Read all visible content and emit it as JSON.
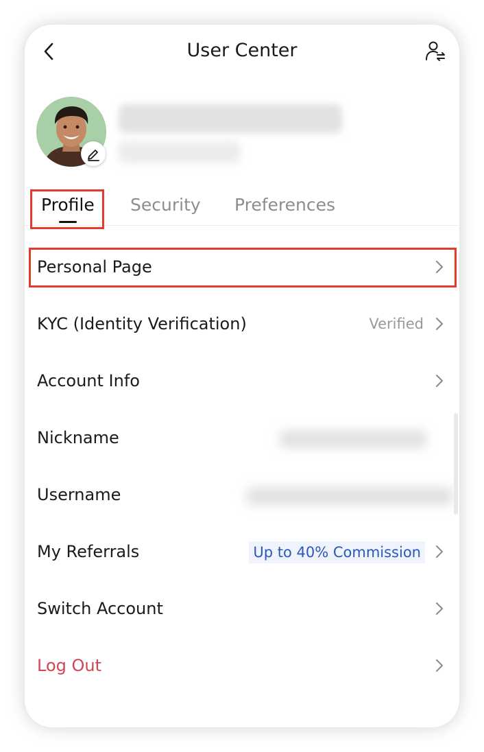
{
  "header": {
    "title": "User Center",
    "back_icon": "chevron-left-icon",
    "switch_icon": "user-switch-icon"
  },
  "profile": {
    "avatar_icon": "avatar",
    "edit_icon": "pencil-icon"
  },
  "tabs": [
    {
      "label": "Profile",
      "active": true
    },
    {
      "label": "Security",
      "active": false
    },
    {
      "label": "Preferences",
      "active": false
    }
  ],
  "menu": {
    "personal_page": "Personal Page",
    "kyc": "KYC (Identity Verification)",
    "kyc_status": "Verified",
    "account_info": "Account Info",
    "nickname": "Nickname",
    "username": "Username",
    "referrals": "My Referrals",
    "referrals_promo": "Up to 40% Commission",
    "switch_account": "Switch Account",
    "log_out": "Log Out"
  },
  "colors": {
    "highlight": "#e23a2c",
    "danger": "#d34452",
    "promo_text": "#2c59b7",
    "promo_bg": "#eef3fc"
  }
}
